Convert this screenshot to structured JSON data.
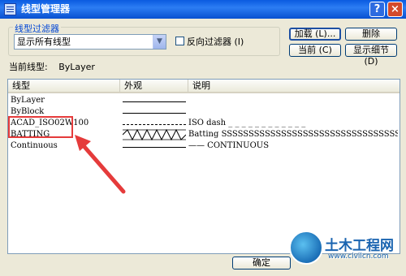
{
  "window": {
    "title": "线型管理器",
    "help": "?",
    "close": "×"
  },
  "filter": {
    "group_label": "线型过滤器",
    "selected": "显示所有线型",
    "invert_label": "反向过滤器 (I)"
  },
  "buttons": {
    "load": "加载 (L)...",
    "delete": "删除",
    "current": "当前 (C)",
    "details": "显示细节 (D)",
    "ok": "确定"
  },
  "current": {
    "label": "当前线型:",
    "value": "ByLayer"
  },
  "table": {
    "headers": [
      "线型",
      "外观",
      "说明"
    ],
    "rows": [
      {
        "name": "ByLayer",
        "look": "solid",
        "desc": ""
      },
      {
        "name": "ByBlock",
        "look": "solid",
        "desc": ""
      },
      {
        "name": "ACAD_ISO02W100",
        "look": "dash",
        "desc": "ISO dash _ _ _ _ _ _ _ _ _ _ _ _"
      },
      {
        "name": "BATTING",
        "look": "batting",
        "desc": "Batting SSSSSSSSSSSSSSSSSSSSSSSSSSSSSSSSSSS"
      },
      {
        "name": "Continuous",
        "look": "solid",
        "desc": "—— CONTINUOUS"
      }
    ]
  },
  "watermark": {
    "brand": "土木工程网",
    "url": "www.civilcn.com"
  },
  "colors": {
    "title_bar": "#0a5ae0",
    "highlight": "#e53b3b",
    "group_label": "#0046d5"
  }
}
